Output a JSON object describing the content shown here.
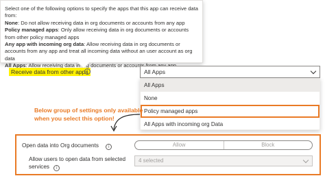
{
  "tooltip": {
    "intro": "Select one of the following options to specify the apps that this app can receive data from:",
    "items": [
      {
        "term": "None",
        "desc": ": Do not allow receiving data in org documents or accounts from any app"
      },
      {
        "term": "Policy managed apps",
        "desc": ": Only allow receiving data in org documents or accounts from other policy managed apps"
      },
      {
        "term": "Any app with incoming org data",
        "desc": ": Allow receiving data in org documents or accounts from any app and treat all incoming data without an user account as org data"
      },
      {
        "term": "All Apps",
        "desc": ": Allow receiving data in org documents or accounts from any app"
      }
    ]
  },
  "receive": {
    "label": "Receive data from other apps",
    "info_icon": "info-icon",
    "selected": "All Apps",
    "options": [
      "All Apps",
      "None",
      "Policy managed apps",
      "All Apps with incoming org Data"
    ],
    "selected_index": 0,
    "highlighted_index": 2
  },
  "note": {
    "text": "Below group of settings only available when you select this option!"
  },
  "settings": {
    "open_data_label": "Open data into Org documents",
    "toggle_allow": "Allow",
    "toggle_block": "Block",
    "allow_users_label": "Allow users to open data from selected services",
    "services_selected": "4 selected"
  },
  "colors": {
    "accent_orange": "#e97a25",
    "highlight_yellow": "#fff200",
    "selected_option_bg": "#edebe9"
  }
}
